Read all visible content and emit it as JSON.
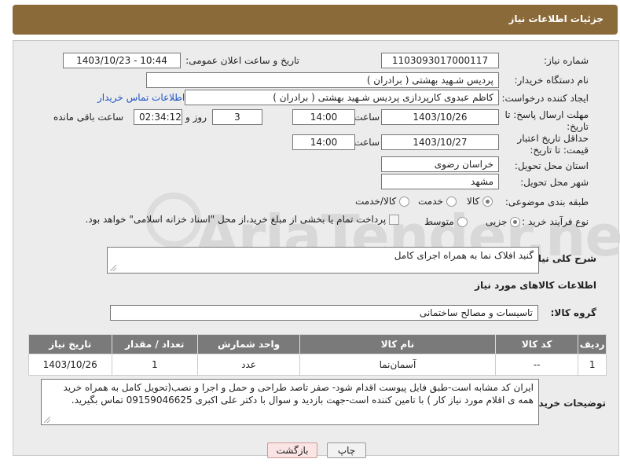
{
  "header": {
    "title": "جزئیات اطلاعات نیاز"
  },
  "form": {
    "need_number_label": "شماره نیاز:",
    "need_number": "1103093017000117",
    "announce_label": "تاریخ و ساعت اعلان عمومی:",
    "announce_value": "1403/10/23 - 10:44",
    "buyer_org_label": "نام دستگاه خریدار:",
    "buyer_org": "پردیس شـهید بهشتی ( برادران )",
    "creator_label": "ایجاد کننده درخواست:",
    "creator": "کاظم  عبدوی  کارپردازی  پردیس شـهید بهشتی ( برادران )",
    "contact_link": "اطلاعات تماس خریدار",
    "deadline_label": "مهلت ارسال پاسخ: تا تاریخ:",
    "deadline_date": "1403/10/26",
    "time_label": "ساعت",
    "deadline_time": "14:00",
    "days_value": "3",
    "days_label": "روز و",
    "remaining_time": "02:34:12",
    "remaining_label": "ساعت باقی مانده",
    "validity_label": "حداقل تاریخ اعتبار قیمت: تا تاریخ:",
    "validity_date": "1403/10/27",
    "validity_time": "14:00",
    "province_label": "استان محل تحویل:",
    "province": "خراسان رضوی",
    "city_label": "شهر محل تحویل:",
    "city": "مشهد",
    "category_label": "طبقه بندی موضوعی:",
    "category_options": [
      "کالا",
      "خدمت",
      "کالا/خدمت"
    ],
    "process_label": "نوع فرآیند خرید :",
    "process_options": [
      "جزیی",
      "متوسط"
    ],
    "payment_note": "پرداخت تمام یا بخشی از مبلغ خرید،از محل \"اسناد خزانه اسلامی\" خواهد بود."
  },
  "description": {
    "label": "شرح کلی نیاز:",
    "text": "گنبد افلاک نما به همراه اجرای کامل"
  },
  "goods_section": {
    "title": "اطلاعات کالاهای مورد نیاز",
    "group_label": "گروه کالا:",
    "group_value": "تاسیسات و مصالح ساختمانی"
  },
  "table": {
    "headers": [
      "ردیف",
      "کد کالا",
      "نام کالا",
      "واحد شمارش",
      "تعداد / مقدار",
      "تاریخ نیاز"
    ],
    "rows": [
      [
        "1",
        "--",
        "آسمان‌نما",
        "عدد",
        "1",
        "1403/10/26"
      ]
    ]
  },
  "buyer_notes": {
    "label": "توضیحات خریدار:",
    "text": "ایران کد مشابه است-طبق فایل پیوست اقدام شود- صفر تاصد طراحی و حمل و اجرا و نصب(تحویل کامل به همراه خرید همه ی اقلام مورد نیاز کار ) با تامین کننده است-جهت  بازدید و سوال با دکتر علی اکبری 09159046625 تماس بگیرید."
  },
  "buttons": {
    "print": "چاپ",
    "back": "بازگشت"
  },
  "watermark": "AriaTender.net"
}
